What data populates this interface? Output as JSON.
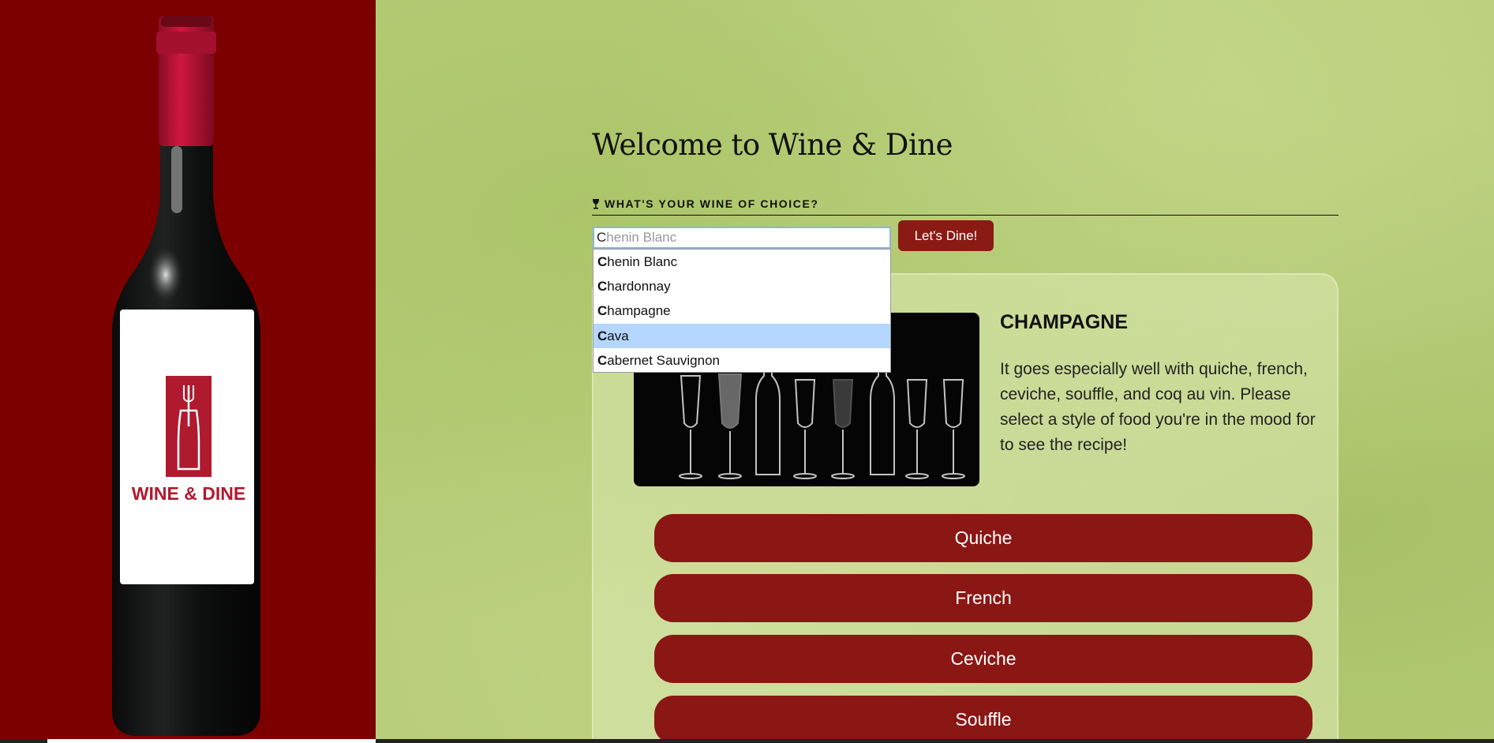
{
  "brand": {
    "logo_text": "WINE & DINE"
  },
  "header": {
    "title": "Welcome to Wine & Dine"
  },
  "search": {
    "question": "WHAT'S YOUR WINE OF CHOICE?",
    "typed": "C",
    "hint": "henin Blanc",
    "button_label": "Let's Dine!"
  },
  "autocomplete": {
    "options": [
      {
        "first": "C",
        "rest": "henin Blanc"
      },
      {
        "first": "C",
        "rest": "hardonnay"
      },
      {
        "first": "C",
        "rest": "hampagne"
      },
      {
        "first": "C",
        "rest": "ava"
      },
      {
        "first": "C",
        "rest": "abernet Sauvignon"
      }
    ]
  },
  "result": {
    "wine_name": "CHAMPAGNE",
    "description": "It goes especially well with quiche, french, ceviche, souffle, and coq au vin. Please select a style of food you're in the mood for to see the recipe!"
  },
  "foods": [
    "Quiche",
    "French",
    "Ceviche",
    "Souffle"
  ],
  "colors": {
    "left_panel": "#7d0000",
    "accent": "#8a1714",
    "background": "#b8cd7a",
    "highlight": "#b5d6ff"
  }
}
